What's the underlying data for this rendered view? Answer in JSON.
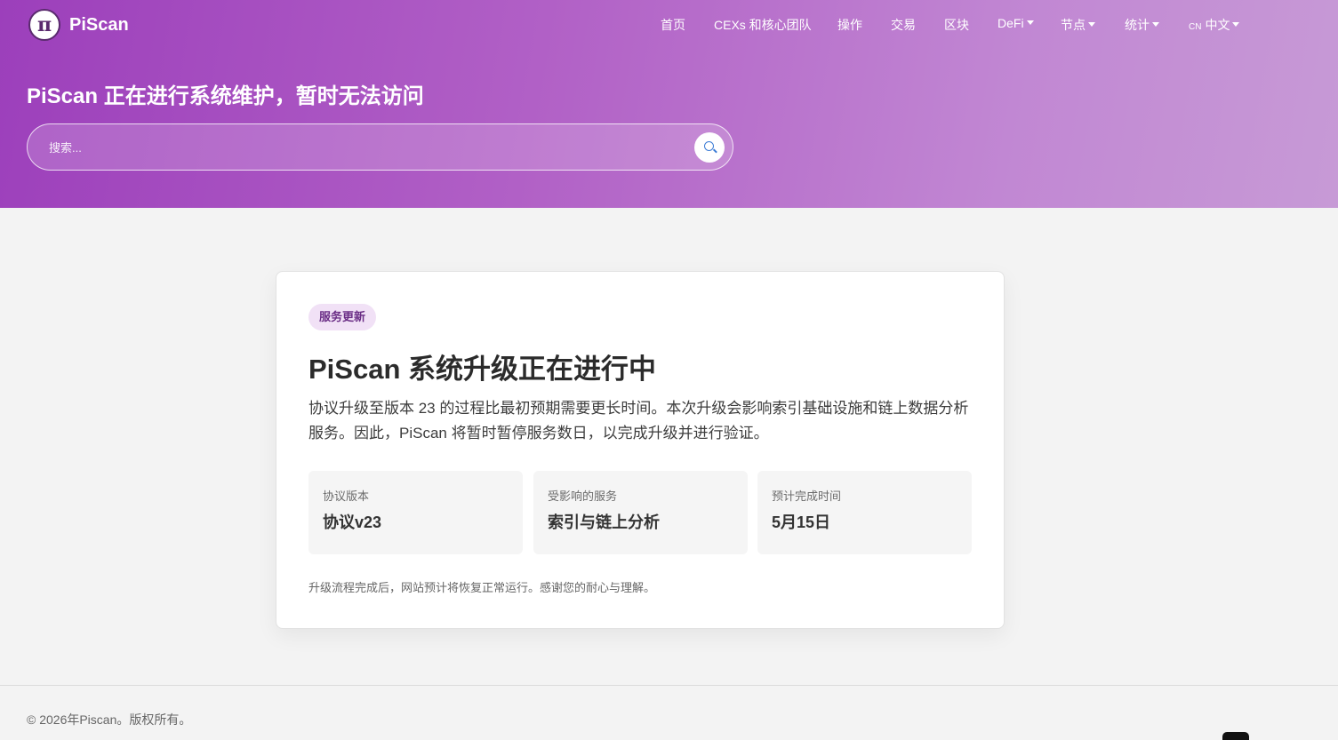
{
  "brand": {
    "name": "PiScan",
    "logo_glyph": "π"
  },
  "nav": {
    "home": "首页",
    "cexs": "CEXs 和核心团队",
    "operations": "操作",
    "transactions": "交易",
    "blocks": "区块",
    "defi": "DeFi",
    "nodes": "节点",
    "stats": "统计",
    "language_code": "CN",
    "language": "中文"
  },
  "hero": {
    "title": "PiScan 正在进行系统维护，暂时无法访问",
    "search_placeholder": "搜索..."
  },
  "notice": {
    "badge": "服务更新",
    "title": "PiScan 系统升级正在进行中",
    "description": "协议升级至版本 23 的过程比最初预期需要更长时间。本次升级会影响索引基础设施和链上数据分析服务。因此，PiScan 将暂时暂停服务数日，以完成升级并进行验证。",
    "info": [
      {
        "label": "协议版本",
        "value": "协议v23"
      },
      {
        "label": "受影响的服务",
        "value": "索引与链上分析"
      },
      {
        "label": "预计完成时间",
        "value": "5月15日"
      }
    ],
    "note": "升级流程完成后，网站预计将恢复正常运行。感谢您的耐心与理解。"
  },
  "footer": {
    "copyright": "© 2026年Piscan。版权所有。"
  },
  "colors": {
    "hero_start": "#9c3fbb",
    "hero_end": "#c79ad6",
    "badge_bg": "#f1e1f6",
    "badge_text": "#6b2e86",
    "search_icon": "#3a7bd5"
  },
  "icons": {
    "search": "search-icon",
    "social": "x-social-icon"
  }
}
